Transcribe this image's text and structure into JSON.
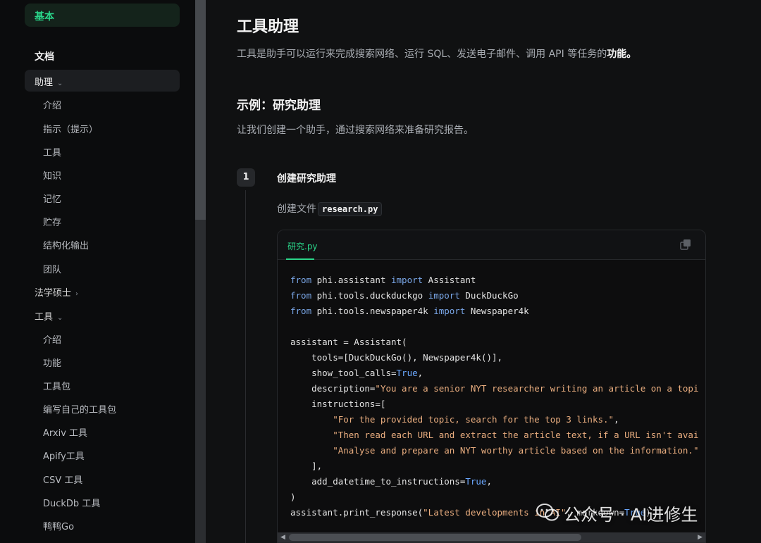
{
  "sidebar": {
    "top_item": "基本",
    "section_heading": "文档",
    "groups": [
      {
        "label": "助理",
        "expanded": true
      },
      {
        "label": "法学硕士",
        "expanded": false
      },
      {
        "label": "工具",
        "expanded": true
      }
    ],
    "assistant_items": [
      "介绍",
      "指示（提示）",
      "工具",
      "知识",
      "记忆",
      "贮存",
      "结构化输出",
      "团队"
    ],
    "tools_items": [
      "介绍",
      "功能",
      "工具包",
      "编写自己的工具包",
      "Arxiv 工具",
      "Apify工具",
      "CSV 工具",
      "DuckDb 工具",
      "鸭鸭Go"
    ]
  },
  "main": {
    "title": "工具助理",
    "intro_text": "工具是助手可以运行来完成搜索网络、运行 SQL、发送电子邮件、调用 API 等任务的",
    "intro_bold": "功能。",
    "example_heading": "示例：研究助理",
    "example_desc": "让我们创建一个助手，通过搜索网络来准备研究报告。",
    "step": {
      "number": "1",
      "title": "创建研究助理",
      "file_text": "创建文件",
      "file_name": "research.py"
    },
    "code": {
      "tab_label": "研究.py",
      "lines": [
        [
          [
            "kw",
            "from"
          ],
          [
            "txt",
            " phi.assistant "
          ],
          [
            "kw",
            "import"
          ],
          [
            "txt",
            " Assistant"
          ]
        ],
        [
          [
            "kw",
            "from"
          ],
          [
            "txt",
            " phi.tools.duckduckgo "
          ],
          [
            "kw",
            "import"
          ],
          [
            "txt",
            " DuckDuckGo"
          ]
        ],
        [
          [
            "kw",
            "from"
          ],
          [
            "txt",
            " phi.tools.newspaper4k "
          ],
          [
            "kw",
            "import"
          ],
          [
            "txt",
            " Newspaper4k"
          ]
        ],
        [],
        [
          [
            "txt",
            "assistant = Assistant("
          ]
        ],
        [
          [
            "txt",
            "    tools=[DuckDuckGo(), Newspaper4k()],"
          ]
        ],
        [
          [
            "txt",
            "    show_tool_calls="
          ],
          [
            "bool",
            "True"
          ],
          [
            "txt",
            ","
          ]
        ],
        [
          [
            "txt",
            "    description="
          ],
          [
            "str",
            "\"You are a senior NYT researcher writing an article on a topi"
          ]
        ],
        [
          [
            "txt",
            "    instructions=["
          ]
        ],
        [
          [
            "str",
            "        \"For the provided topic, search for the top 3 links.\""
          ],
          [
            "txt",
            ","
          ]
        ],
        [
          [
            "str",
            "        \"Then read each URL and extract the article text, if a URL isn't avai"
          ]
        ],
        [
          [
            "str",
            "        \"Analyse and prepare an NYT worthy article based on the information.\""
          ]
        ],
        [
          [
            "txt",
            "    ],"
          ]
        ],
        [
          [
            "txt",
            "    add_datetime_to_instructions="
          ],
          [
            "bool",
            "True"
          ],
          [
            "txt",
            ","
          ]
        ],
        [
          [
            "txt",
            ")"
          ]
        ],
        [
          [
            "txt",
            "assistant.print_response("
          ],
          [
            "str",
            "\"Latest developments in AI\""
          ],
          [
            "txt",
            ", markdown="
          ],
          [
            "bool",
            "True"
          ],
          [
            "txt",
            ")"
          ]
        ]
      ]
    }
  },
  "watermark": {
    "text": "公众号 · AI进修生"
  },
  "colors": {
    "accent": "#2ad68a",
    "keyword": "#7aa7e8",
    "string": "#e9ad7f"
  }
}
